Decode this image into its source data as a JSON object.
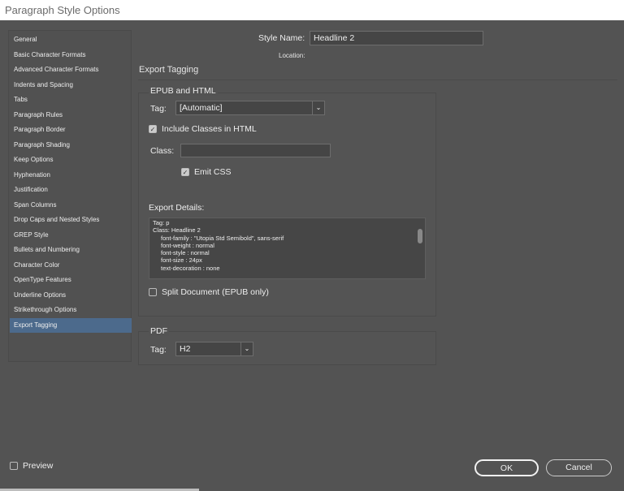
{
  "window": {
    "title": "Paragraph Style Options"
  },
  "sidebar": {
    "items": [
      "General",
      "Basic Character Formats",
      "Advanced Character Formats",
      "Indents and Spacing",
      "Tabs",
      "Paragraph Rules",
      "Paragraph Border",
      "Paragraph Shading",
      "Keep Options",
      "Hyphenation",
      "Justification",
      "Span Columns",
      "Drop Caps and Nested Styles",
      "GREP Style",
      "Bullets and Numbering",
      "Character Color",
      "OpenType Features",
      "Underline Options",
      "Strikethrough Options",
      "Export Tagging"
    ],
    "selected": "Export Tagging"
  },
  "header": {
    "style_name_label": "Style Name:",
    "style_name_value": "Headline 2",
    "location_label": "Location:"
  },
  "section_title": "Export Tagging",
  "epub": {
    "title": "EPUB and HTML",
    "tag_label": "Tag:",
    "tag_value": "[Automatic]",
    "include_classes_label": "Include Classes in HTML",
    "include_classes_checked": true,
    "class_label": "Class:",
    "class_value": "",
    "emit_css_label": "Emit CSS",
    "emit_css_checked": true,
    "export_details_label": "Export Details:",
    "export_details": [
      "Tag: p",
      "Class: Headline 2"
    ],
    "export_details_props": [
      "font-family : \"Utopia Std Semibold\", sans-serif",
      "font-weight : normal",
      "font-style : normal",
      "font-size : 24px",
      "text-decoration : none"
    ],
    "split_label": "Split Document (EPUB only)",
    "split_checked": false
  },
  "pdf": {
    "title": "PDF",
    "tag_label": "Tag:",
    "tag_value": "H2"
  },
  "footer": {
    "preview_label": "Preview",
    "preview_checked": false,
    "ok_label": "OK",
    "cancel_label": "Cancel"
  }
}
